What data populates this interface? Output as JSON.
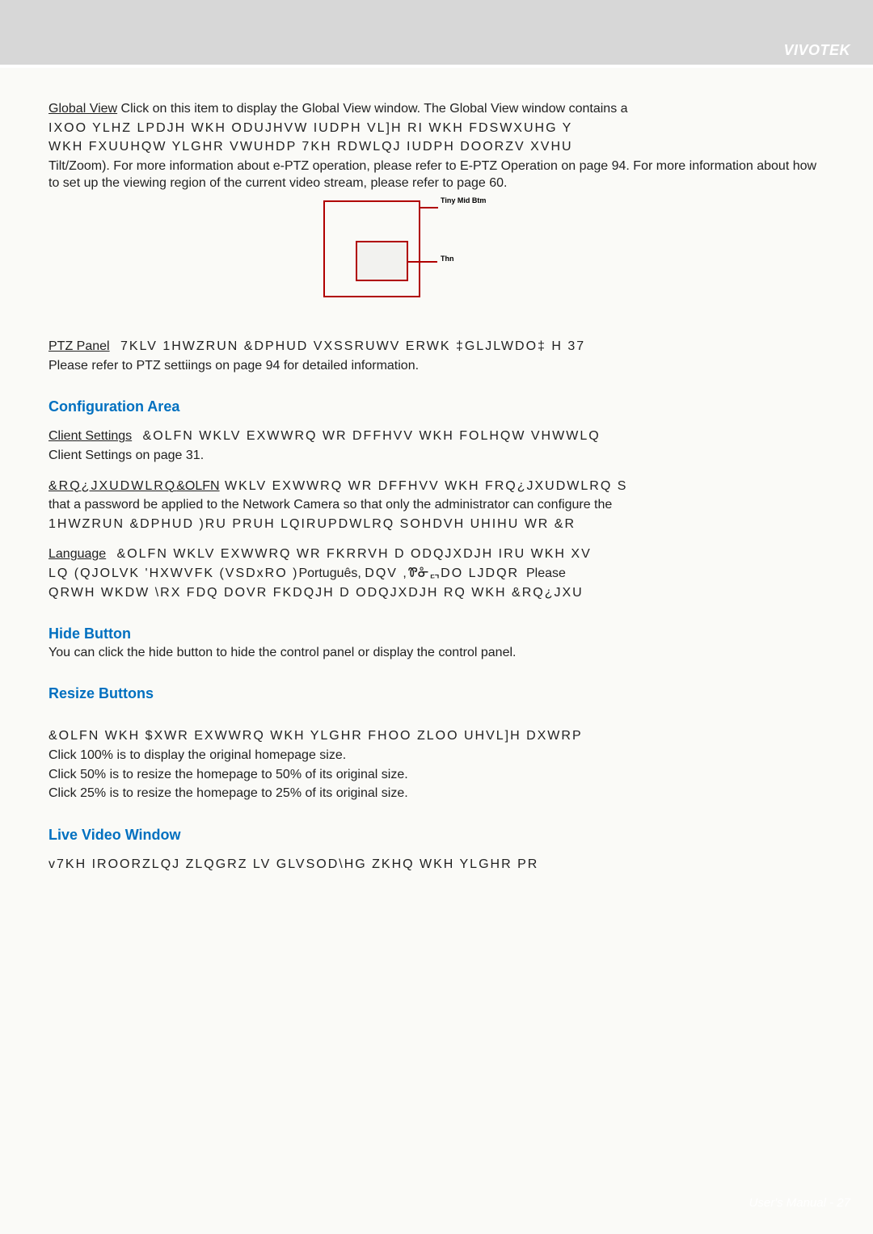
{
  "brand": "VIVOTEK",
  "globalView": {
    "label": "Global View",
    "p1a": " Click on this item to display the Global View window. The Global View window contains a ",
    "p1b": "IXOO YLHZ LPDJH  WKH ODUJHVW IUDPH VL]H RI WKH FDSWXUHG Y",
    "p1c": "WKH FXUUHQW YLGHR VWUHDP   7KH  RDWLQJ IUDPH DOORZV XVHU",
    "p1d": "Tilt/Zoom). For more information about e-PTZ operation, please refer to E-PTZ Operation on page 94. For more information about how to set up the viewing region of the current video stream, please refer to page 60."
  },
  "diagram": {
    "topLabel": "Tiny\nMid\nBtm",
    "midLabel": "Thn"
  },
  "ptz": {
    "label": "PTZ Panel",
    "line1": "7KLV 1HWZRUN &DPHUD VXSSRUWV ERWK ‡GLJLWDO‡  H 37",
    "line2": "Please refer to PTZ settiings on page 94 for detailed information."
  },
  "configArea": {
    "heading": "Configuration Area",
    "client": {
      "label": "Client Settings",
      "line1": "&OLFN WKLV EXWWRQ WR DFFHVV WKH FOLHQW VHWWLQ",
      "line2": "Client Settings on page 31."
    },
    "configure": {
      "label": " &RQ¿JXUDWLRQ",
      "tail": "&OLFN",
      "line1": "WKLV EXWWRQ WR DFFHVV WKH FRQ¿JXUDWLRQ S",
      "line2": "that a password be applied to the Network Camera so that only the administrator can configure the ",
      "line3": " 1HWZRUN &DPHUD  )RU PRUH LQIRUPDWLRQ  SOHDVH UHIHU WR &R"
    },
    "language": {
      "label": "Language",
      "line1": "&OLFN WKLV EXWWRQ WR FKRRVH D ODQJXDJH IRU WKH XV",
      "line2a": "LQ  (QJOLVK  'HXWVFK  (VSDxRO  )",
      "line2b": "Português, ",
      "line2c": "DQV  ,",
      "line2d": "Ꮘᓁᇊ",
      "line2e": "DO LJDQR",
      "line2f": "Please ",
      "line3": "QRWH WKDW \\RX FDQ DOVR FKDQJH D ODQJXDJH RQ WKH &RQ¿JXU"
    }
  },
  "hide": {
    "heading": "Hide Button",
    "text": "You can click the hide button to hide the control panel or display the control panel."
  },
  "resize": {
    "heading": "Resize Buttons",
    "line1": " &OLFN WKH $XWR EXWWRQ  WKH YLGHR FHOO ZLOO UHVL]H DXWRP",
    "line2": "Click 100% is to display the original homepage size.",
    "line3": "Click 50% is to resize the homepage to 50% of its original size.",
    "line4": "Click 25% is to resize the homepage to 25% of its original size."
  },
  "live": {
    "heading": "Live Video Window",
    "line1": " v7KH IROORZLQJ ZLQGRZ LV GLVSOD\\HG ZKHQ WKH YLGHR PR"
  },
  "footer": "User's Manual - 27"
}
